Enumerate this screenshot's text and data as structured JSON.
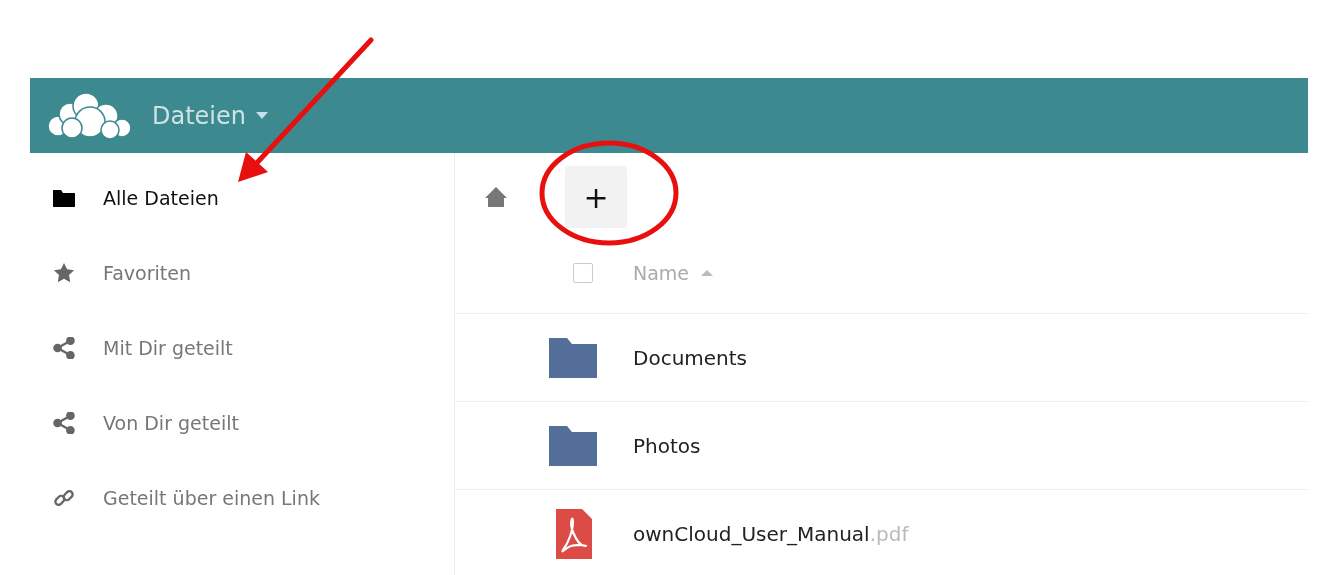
{
  "header": {
    "app_name": "Dateien"
  },
  "sidebar": {
    "items": [
      {
        "label": "Alle Dateien",
        "kind": "folder",
        "selected": true
      },
      {
        "label": "Favoriten",
        "kind": "star",
        "selected": false
      },
      {
        "label": "Mit Dir geteilt",
        "kind": "share",
        "selected": false
      },
      {
        "label": "Von Dir geteilt",
        "kind": "share",
        "selected": false
      },
      {
        "label": "Geteilt über einen Link",
        "kind": "link",
        "selected": false
      }
    ]
  },
  "toolbar": {
    "new_button": "+"
  },
  "table": {
    "select_all_checked": false,
    "columns": [
      {
        "label": "Name"
      }
    ],
    "rows": [
      {
        "kind": "folder",
        "name": "Documents"
      },
      {
        "kind": "folder",
        "name": "Photos"
      },
      {
        "kind": "pdf",
        "name": "ownCloud_User_Manual",
        "extension": ".pdf"
      }
    ]
  }
}
